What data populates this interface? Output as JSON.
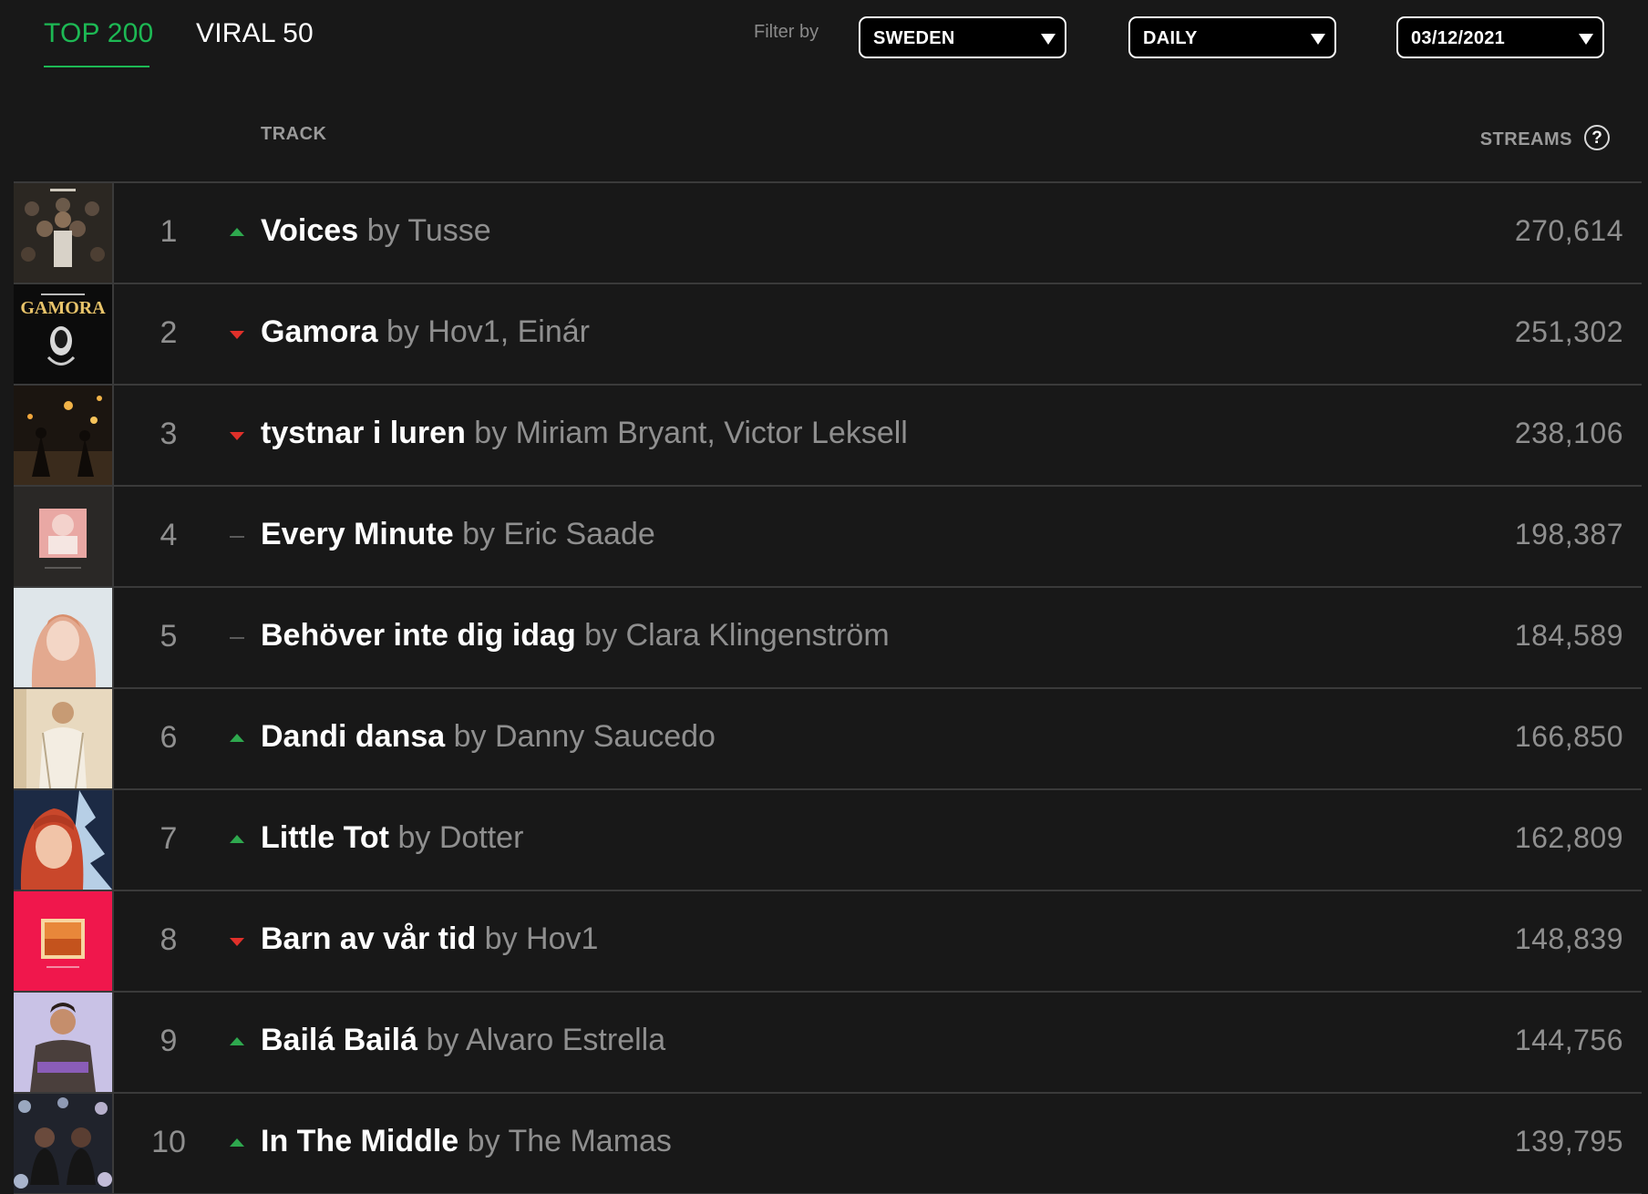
{
  "tabs": {
    "top200": "TOP 200",
    "viral50": "VIRAL 50"
  },
  "filter": {
    "label": "Filter by",
    "country": "SWEDEN",
    "frequency": "DAILY",
    "date": "03/12/2021"
  },
  "table": {
    "track_header": "TRACK",
    "streams_header": "STREAMS",
    "help_glyph": "?"
  },
  "colors": {
    "accent": "#1db954",
    "up": "#2ea84e",
    "down": "#e0302a",
    "background": "#181818"
  },
  "rows": [
    {
      "pos": "1",
      "trend": "up",
      "song": "Voices",
      "by": "by",
      "artist": "Tusse",
      "streams": "270,614"
    },
    {
      "pos": "2",
      "trend": "down",
      "song": "Gamora",
      "by": "by",
      "artist": "Hov1, Einár",
      "streams": "251,302",
      "art_text": "GAMORA"
    },
    {
      "pos": "3",
      "trend": "down",
      "song": "tystnar i luren",
      "by": "by",
      "artist": "Miriam Bryant, Victor Leksell",
      "streams": "238,106"
    },
    {
      "pos": "4",
      "trend": "same",
      "song": "Every Minute",
      "by": "by",
      "artist": "Eric Saade",
      "streams": "198,387"
    },
    {
      "pos": "5",
      "trend": "same",
      "song": "Behöver inte dig idag",
      "by": "by",
      "artist": "Clara Klingenström",
      "streams": "184,589"
    },
    {
      "pos": "6",
      "trend": "up",
      "song": "Dandi dansa",
      "by": "by",
      "artist": "Danny Saucedo",
      "streams": "166,850"
    },
    {
      "pos": "7",
      "trend": "up",
      "song": "Little Tot",
      "by": "by",
      "artist": "Dotter",
      "streams": "162,809"
    },
    {
      "pos": "8",
      "trend": "down",
      "song": "Barn av vår tid",
      "by": "by",
      "artist": "Hov1",
      "streams": "148,839"
    },
    {
      "pos": "9",
      "trend": "up",
      "song": "Bailá Bailá",
      "by": "by",
      "artist": "Alvaro Estrella",
      "streams": "144,756"
    },
    {
      "pos": "10",
      "trend": "up",
      "song": "In The Middle",
      "by": "by",
      "artist": "The Mamas",
      "streams": "139,795"
    }
  ]
}
